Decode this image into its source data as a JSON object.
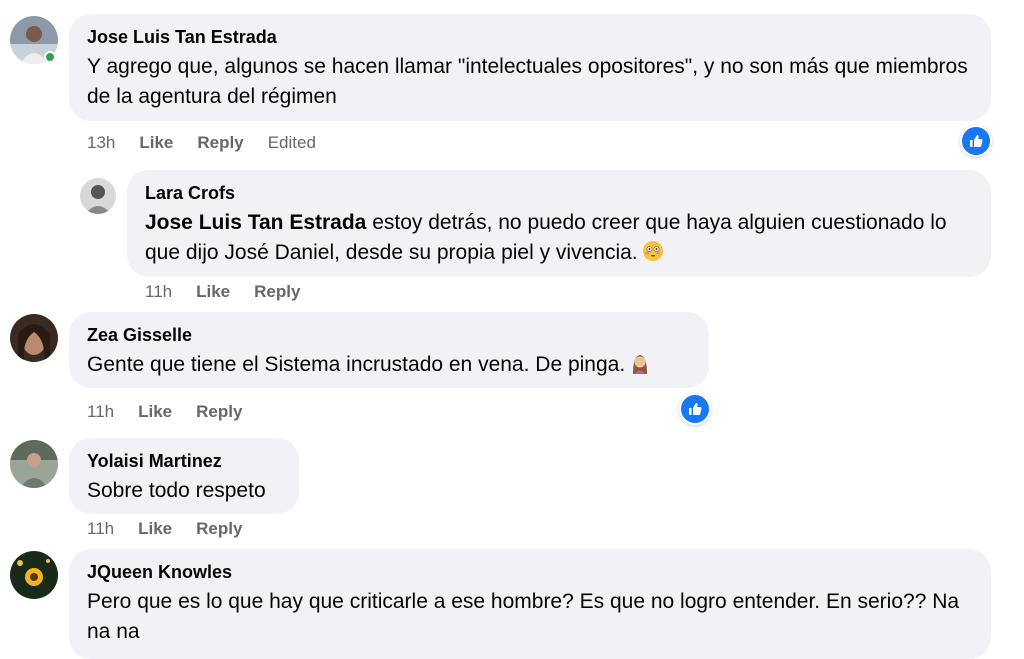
{
  "comments": [
    {
      "author": "Jose Luis Tan Estrada",
      "text": "Y agrego que, algunos se hacen llamar \"intelectuales opositores\", y no son más que miembros de la agentura del régimen",
      "time": "13h",
      "like_label": "Like",
      "reply_label": "Reply",
      "edited_label": "Edited"
    },
    {
      "author": "Lara Crofs",
      "mention": "Jose Luis Tan Estrada",
      "text": " estoy detrás, no puedo creer que haya alguien cuestionado lo que dijo José Daniel, desde su propia piel y vivencia.",
      "emoji": "flushed-face",
      "time": "11h",
      "like_label": "Like",
      "reply_label": "Reply"
    },
    {
      "author": "Zea Gisselle",
      "text": "Gente que tiene el Sistema incrustado en vena. De pinga.",
      "emoji": "woman-facepalming",
      "time": "11h",
      "like_label": "Like",
      "reply_label": "Reply"
    },
    {
      "author": "Yolaisi Martinez",
      "text": "Sobre todo respeto",
      "time": "11h",
      "like_label": "Like",
      "reply_label": "Reply"
    },
    {
      "author": "JQueen Knowles",
      "text": "Pero que es lo que hay que criticarle a ese hombre? Es que no logro entender. En serio?? Na na na"
    }
  ],
  "colors": {
    "bubble": "#f0f2f5",
    "meta": "#65676b",
    "like_blue": "#1877f2",
    "online": "#31a24c"
  }
}
